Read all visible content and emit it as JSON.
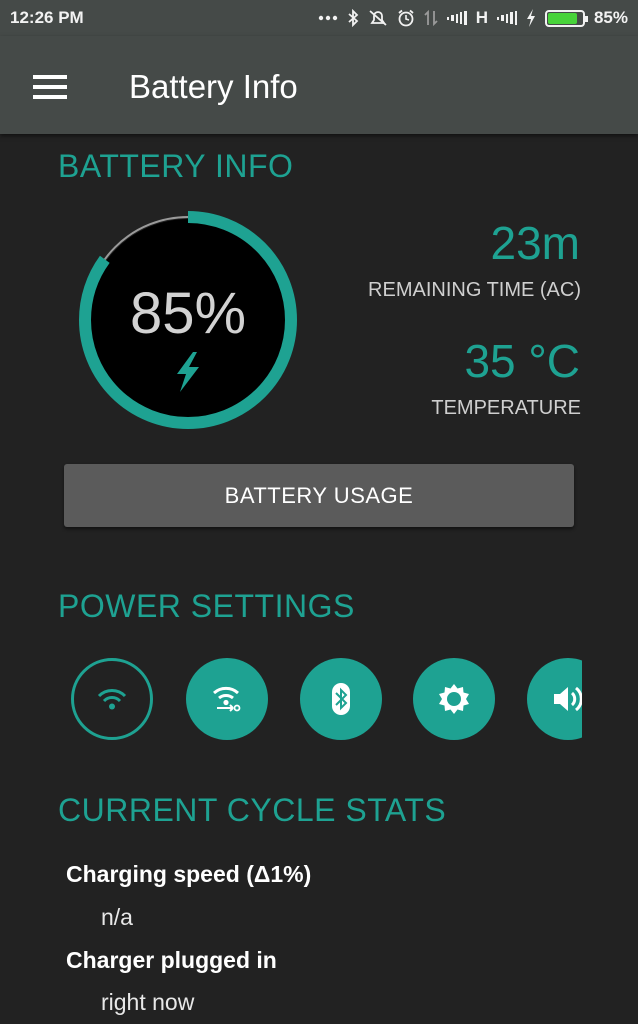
{
  "status_bar": {
    "time": "12:26 PM",
    "network_type": "H",
    "battery_percent": "85%",
    "battery_level": 0.85,
    "icons": [
      "more-dots-icon",
      "bluetooth-icon",
      "silent-icon",
      "alarm-icon",
      "data-icon",
      "signal-icon",
      "signal-icon",
      "charging-icon",
      "battery-icon"
    ]
  },
  "app_bar": {
    "title": "Battery Info"
  },
  "battery_info": {
    "section_title": "BATTERY INFO",
    "level_text": "85%",
    "level": 0.85,
    "remaining_time": "23m",
    "remaining_time_label": "REMAINING TIME (AC)",
    "temperature": "35 °C",
    "temperature_label": "TEMPERATURE",
    "usage_button": "BATTERY USAGE"
  },
  "power_settings": {
    "section_title": "POWER SETTINGS",
    "toggles": [
      {
        "name": "wifi-icon",
        "state": "off"
      },
      {
        "name": "hotspot-icon",
        "state": "on"
      },
      {
        "name": "bluetooth-icon",
        "state": "on"
      },
      {
        "name": "brightness-icon",
        "state": "on"
      },
      {
        "name": "volume-icon",
        "state": "on"
      }
    ]
  },
  "cycle_stats": {
    "section_title": "CURRENT CYCLE STATS",
    "items": [
      {
        "label": "Charging speed (Δ1%)",
        "value": "n/a"
      },
      {
        "label": "Charger plugged in",
        "value": "right now"
      }
    ]
  },
  "colors": {
    "accent": "#1ea292",
    "bar": "#454a48",
    "background": "#222222",
    "button": "#5b5b5b",
    "battery_fill": "#48d33a"
  }
}
